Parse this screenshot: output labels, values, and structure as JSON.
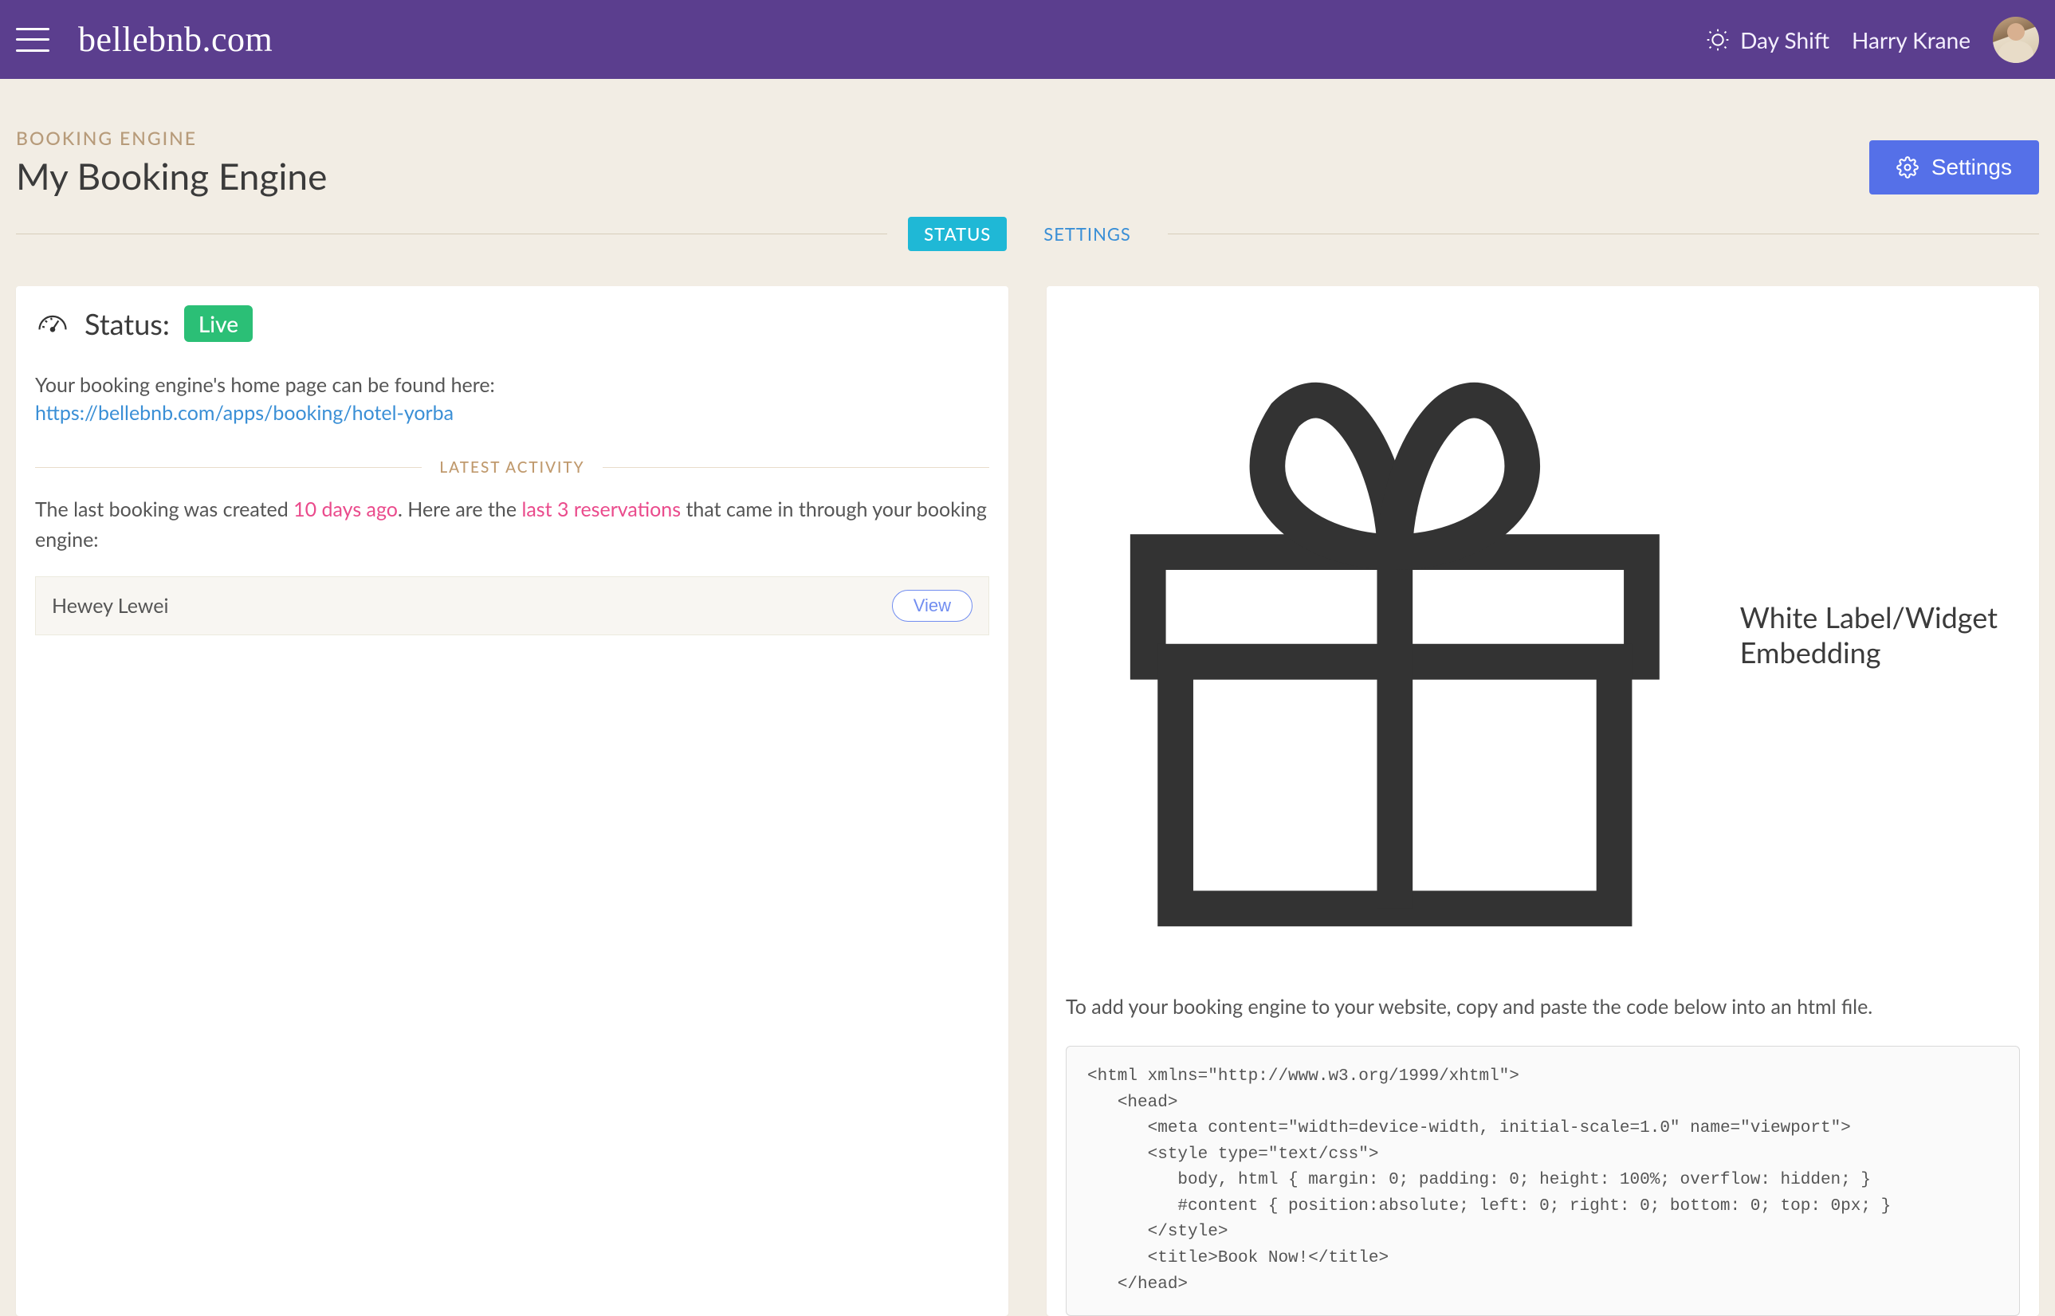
{
  "topbar": {
    "brand": "bellebnb.com",
    "shift_label": "Day Shift",
    "user_name": "Harry Krane"
  },
  "page": {
    "eyebrow": "BOOKING ENGINE",
    "title": "My Booking Engine",
    "settings_button": "Settings"
  },
  "tabs": {
    "status": "STATUS",
    "settings": "SETTINGS"
  },
  "status_card": {
    "heading": "Status:",
    "badge": "Live",
    "lead": "Your booking engine's home page can be found here:",
    "url": "https://bellebnb.com/apps/booking/hotel-yorba",
    "latest_activity_label": "LATEST ACTIVITY",
    "activity_prefix": "The last booking was created ",
    "activity_days": "10 days ago",
    "activity_mid": ". Here are the ",
    "activity_count": "last 3 reservations",
    "activity_suffix": " that came in through your booking engine:",
    "reservation_name": "Hewey Lewei",
    "view_label": "View"
  },
  "embed_card": {
    "heading": "White Label/Widget Embedding",
    "lead": "To add your booking engine to your website, copy and paste the code below into an html file.",
    "code": "<html xmlns=\"http://www.w3.org/1999/xhtml\">\n   <head>\n      <meta content=\"width=device-width, initial-scale=1.0\" name=\"viewport\">\n      <style type=\"text/css\">\n         body, html { margin: 0; padding: 0; height: 100%; overflow: hidden; }\n         #content { position:absolute; left: 0; right: 0; bottom: 0; top: 0px; }\n      </style>\n      <title>Book Now!</title>\n   </head>"
  }
}
